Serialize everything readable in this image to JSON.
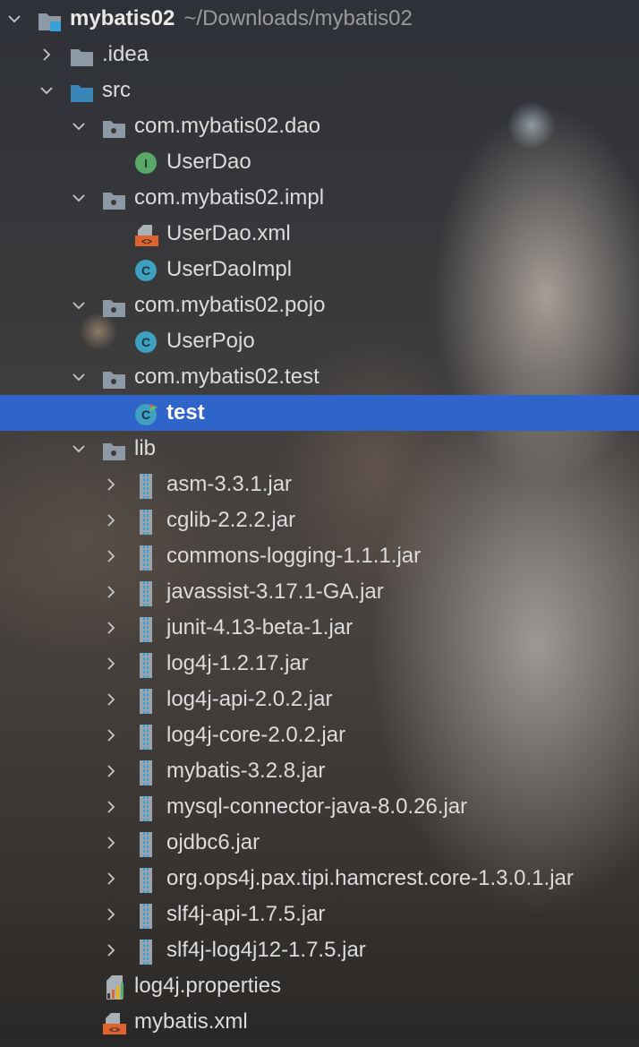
{
  "project": {
    "name": "mybatis02",
    "path": "~/Downloads/mybatis02"
  },
  "tree": {
    "idea": ".idea",
    "src": "src",
    "pkg_dao": "com.mybatis02.dao",
    "user_dao": "UserDao",
    "pkg_impl": "com.mybatis02.impl",
    "user_dao_xml": "UserDao.xml",
    "user_dao_impl": "UserDaoImpl",
    "pkg_pojo": "com.mybatis02.pojo",
    "user_pojo": "UserPojo",
    "pkg_test": "com.mybatis02.test",
    "test": "test",
    "lib": "lib",
    "jars": [
      "asm-3.3.1.jar",
      "cglib-2.2.2.jar",
      "commons-logging-1.1.1.jar",
      "javassist-3.17.1-GA.jar",
      "junit-4.13-beta-1.jar",
      "log4j-1.2.17.jar",
      "log4j-api-2.0.2.jar",
      "log4j-core-2.0.2.jar",
      "mybatis-3.2.8.jar",
      "mysql-connector-java-8.0.26.jar",
      "ojdbc6.jar",
      "org.ops4j.pax.tipi.hamcrest.core-1.3.0.1.jar",
      "slf4j-api-1.7.5.jar",
      "slf4j-log4j12-1.7.5.jar"
    ],
    "log4j_properties": "log4j.properties",
    "mybatis_xml": "mybatis.xml"
  },
  "selected_item": "test",
  "colors": {
    "selection": "#2f65ca",
    "folder": "#6e8fa8",
    "interface_icon": "#59a869",
    "class_icon": "#40a0c0",
    "xml_icon": "#e0632e"
  },
  "icons": {
    "module": "module-folder-icon",
    "folder": "folder-icon",
    "source_folder": "source-folder-icon",
    "package": "package-icon",
    "interface": "interface-icon",
    "class": "class-icon",
    "xml": "xml-file-icon",
    "jar": "jar-icon",
    "properties": "properties-file-icon",
    "chevron_down": "chevron-down-icon",
    "chevron_right": "chevron-right-icon"
  }
}
